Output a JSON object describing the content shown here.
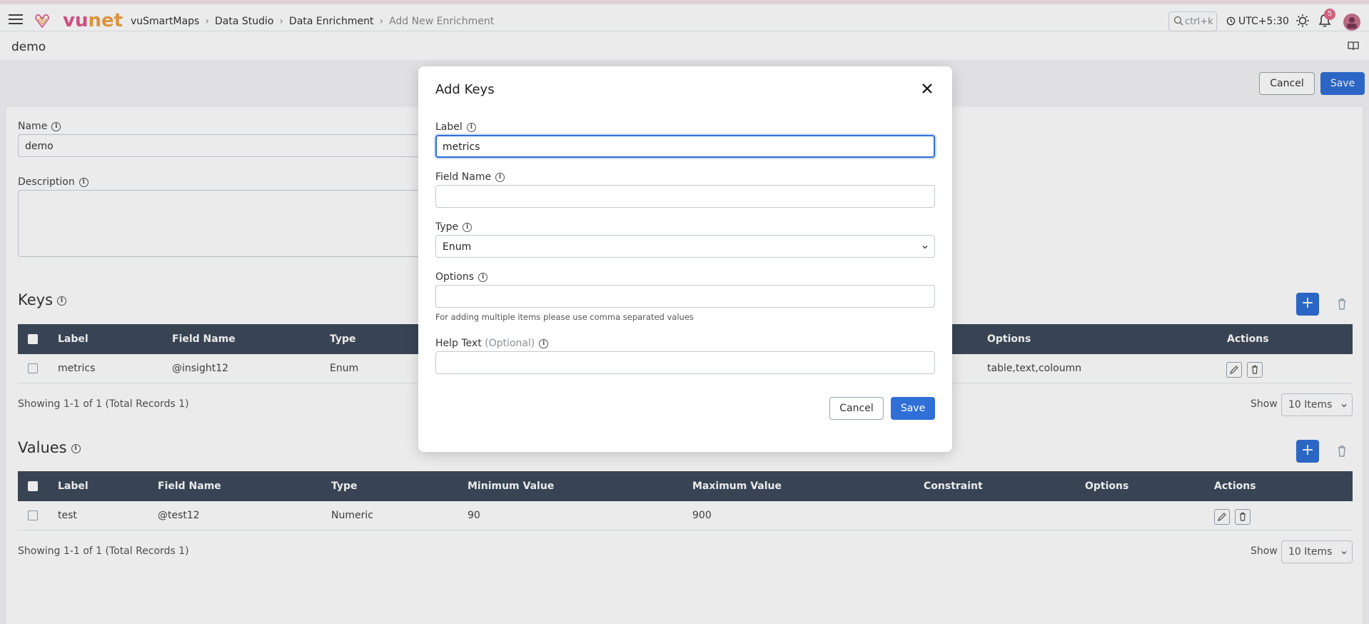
{
  "app": {
    "logo_brand": "vunet",
    "breadcrumbs": [
      "vuSmartMaps",
      "Data Studio",
      "Data Enrichment",
      "Add New Enrichment"
    ],
    "search_hint": "ctrl+k",
    "timezone": "UTC+5:30",
    "notification_count": "5"
  },
  "page": {
    "title": "demo",
    "cancel_label": "Cancel",
    "save_label": "Save"
  },
  "form": {
    "name_label": "Name",
    "name_value": "demo",
    "description_label": "Description",
    "description_value": ""
  },
  "keys": {
    "title": "Keys",
    "columns": [
      "Label",
      "Field Name",
      "Type",
      "Options",
      "Actions"
    ],
    "rows": [
      {
        "label": "metrics",
        "field_name": "@insight12",
        "type": "Enum",
        "options": "table,text,coloumn"
      }
    ],
    "footer": "Showing 1-1 of 1 (Total Records 1)",
    "show_label": "Show",
    "page_size": "10 Items"
  },
  "values": {
    "title": "Values",
    "columns": [
      "Label",
      "Field Name",
      "Type",
      "Minimum Value",
      "Maximum Value",
      "Constraint",
      "Options",
      "Actions"
    ],
    "rows": [
      {
        "label": "test",
        "field_name": "@test12",
        "type": "Numeric",
        "min": "90",
        "max": "900",
        "constraint": "",
        "options": ""
      }
    ],
    "footer": "Showing 1-1 of 1 (Total Records 1)",
    "show_label": "Show",
    "page_size": "10 Items"
  },
  "modal": {
    "title": "Add Keys",
    "label_label": "Label",
    "label_value": "metrics",
    "field_name_label": "Field Name",
    "field_name_value": "",
    "type_label": "Type",
    "type_value": "Enum",
    "options_label": "Options",
    "options_value": "",
    "options_hint": "For adding multiple items please use comma separated values",
    "help_text_label": "Help Text",
    "help_text_optional": "(Optional)",
    "help_text_value": "",
    "cancel_label": "Cancel",
    "save_label": "Save"
  },
  "colors": {
    "primary": "#2f6fd6",
    "table_header": "#3d4a5c",
    "brand_pink": "#e0568a",
    "badge": "#e26a8a"
  }
}
